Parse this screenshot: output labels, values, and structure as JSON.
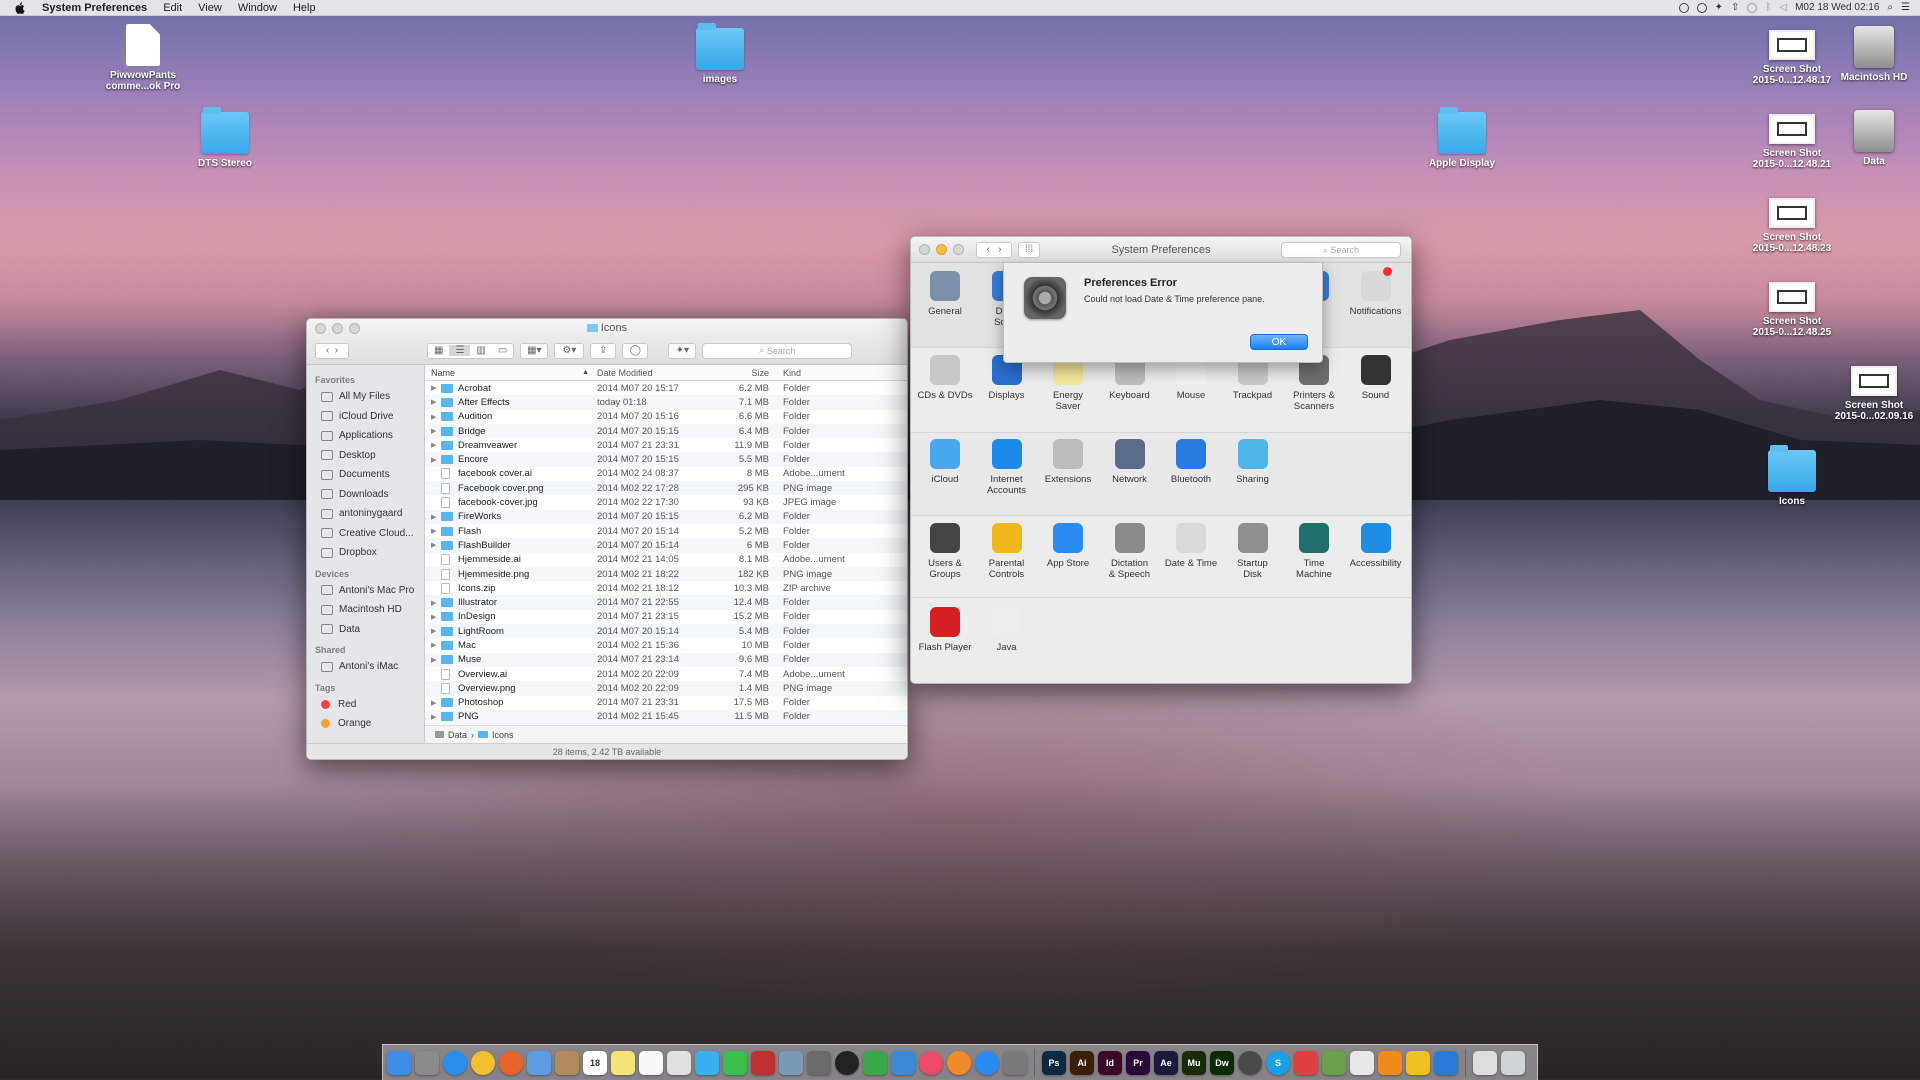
{
  "menubar": {
    "apple": "",
    "app_name": "System Preferences",
    "menus": [
      "Edit",
      "View",
      "Window",
      "Help"
    ],
    "clock": "M02 18 Wed  02:16"
  },
  "desktop_icons": [
    {
      "label": "PiwwowPants\ncomme...ok Pro",
      "type": "doc"
    },
    {
      "label": "DTS Stereo",
      "type": "folder"
    },
    {
      "label": "images",
      "type": "folder"
    },
    {
      "label": "Apple Display",
      "type": "folder"
    },
    {
      "label": "Screen Shot\n2015-0...12.48.17",
      "type": "shot"
    },
    {
      "label": "Macintosh HD",
      "type": "hdd"
    },
    {
      "label": "Screen Shot\n2015-0...12.48.21",
      "type": "shot"
    },
    {
      "label": "Data",
      "type": "hdd"
    },
    {
      "label": "Screen Shot\n2015-0...12.48.23",
      "type": "shot"
    },
    {
      "label": "Screen Shot\n2015-0...12.48.25",
      "type": "shot"
    },
    {
      "label": "Screen Shot\n2015-0...02.09.16",
      "type": "shot"
    },
    {
      "label": "Icons",
      "type": "folder"
    }
  ],
  "finder": {
    "title": "Icons",
    "search_placeholder": "Search",
    "sidebar": {
      "favorites_header": "Favorites",
      "favorites": [
        "All My Files",
        "iCloud Drive",
        "Applications",
        "Desktop",
        "Documents",
        "Downloads",
        "antoninygaard",
        "Creative Cloud...",
        "Dropbox"
      ],
      "devices_header": "Devices",
      "devices": [
        "Antoni's Mac Pro",
        "Macintosh HD",
        "Data"
      ],
      "shared_header": "Shared",
      "shared": [
        "Antoni's iMac"
      ],
      "tags_header": "Tags",
      "tags": [
        {
          "name": "Red",
          "color": "#f0433f"
        },
        {
          "name": "Orange",
          "color": "#f7a131"
        }
      ]
    },
    "columns": {
      "name": "Name",
      "date": "Date Modified",
      "size": "Size",
      "kind": "Kind"
    },
    "files": [
      {
        "name": "Acrobat",
        "date": "2014 M07 20 15:17",
        "size": "6.2 MB",
        "kind": "Folder",
        "folder": true
      },
      {
        "name": "After Effects",
        "date": "today 01:18",
        "size": "7.1 MB",
        "kind": "Folder",
        "folder": true
      },
      {
        "name": "Audition",
        "date": "2014 M07 20 15:16",
        "size": "6.6 MB",
        "kind": "Folder",
        "folder": true
      },
      {
        "name": "Bridge",
        "date": "2014 M07 20 15:15",
        "size": "6.4 MB",
        "kind": "Folder",
        "folder": true
      },
      {
        "name": "Dreamveawer",
        "date": "2014 M07 21 23:31",
        "size": "11.9 MB",
        "kind": "Folder",
        "folder": true
      },
      {
        "name": "Encore",
        "date": "2014 M07 20 15:15",
        "size": "5.5 MB",
        "kind": "Folder",
        "folder": true
      },
      {
        "name": "facebook cover.ai",
        "date": "2014 M02 24 08:37",
        "size": "8 MB",
        "kind": "Adobe...ument",
        "folder": false
      },
      {
        "name": "Facebook cover.png",
        "date": "2014 M02 22 17:28",
        "size": "295 KB",
        "kind": "PNG image",
        "folder": false
      },
      {
        "name": "facebook-cover.jpg",
        "date": "2014 M02 22 17:30",
        "size": "93 KB",
        "kind": "JPEG image",
        "folder": false
      },
      {
        "name": "FireWorks",
        "date": "2014 M07 20 15:15",
        "size": "6.2 MB",
        "kind": "Folder",
        "folder": true
      },
      {
        "name": "Flash",
        "date": "2014 M07 20 15:14",
        "size": "5.2 MB",
        "kind": "Folder",
        "folder": true
      },
      {
        "name": "FlashBuilder",
        "date": "2014 M07 20 15:14",
        "size": "6 MB",
        "kind": "Folder",
        "folder": true
      },
      {
        "name": "Hjemmeside.ai",
        "date": "2014 M02 21 14:05",
        "size": "8.1 MB",
        "kind": "Adobe...ument",
        "folder": false
      },
      {
        "name": "Hjemmeside.png",
        "date": "2014 M02 21 18:22",
        "size": "182 KB",
        "kind": "PNG image",
        "folder": false
      },
      {
        "name": "Icons.zip",
        "date": "2014 M02 21 18:12",
        "size": "10.3 MB",
        "kind": "ZIP archive",
        "folder": false
      },
      {
        "name": "Illustrator",
        "date": "2014 M07 21 22:55",
        "size": "12.4 MB",
        "kind": "Folder",
        "folder": true
      },
      {
        "name": "InDesign",
        "date": "2014 M07 21 23:15",
        "size": "15.2 MB",
        "kind": "Folder",
        "folder": true
      },
      {
        "name": "LightRoom",
        "date": "2014 M07 20 15:14",
        "size": "5.4 MB",
        "kind": "Folder",
        "folder": true
      },
      {
        "name": "Mac",
        "date": "2014 M02 21 15:36",
        "size": "10 MB",
        "kind": "Folder",
        "folder": true
      },
      {
        "name": "Muse",
        "date": "2014 M07 21 23:14",
        "size": "9.6 MB",
        "kind": "Folder",
        "folder": true
      },
      {
        "name": "Overview.ai",
        "date": "2014 M02 20 22:09",
        "size": "7.4 MB",
        "kind": "Adobe...ument",
        "folder": false
      },
      {
        "name": "Overview.png",
        "date": "2014 M02 20 22:09",
        "size": "1.4 MB",
        "kind": "PNG image",
        "folder": false
      },
      {
        "name": "Photoshop",
        "date": "2014 M07 21 23:31",
        "size": "17.5 MB",
        "kind": "Folder",
        "folder": true
      },
      {
        "name": "PNG",
        "date": "2014 M02 21 15:45",
        "size": "11.5 MB",
        "kind": "Folder",
        "folder": true
      }
    ],
    "path": [
      "Data",
      "Icons"
    ],
    "status": "28 items, 2.42 TB available"
  },
  "sysprefs": {
    "title": "System Preferences",
    "search_placeholder": "Search",
    "panes_row1": [
      {
        "label": "General",
        "color": "#7e8fa8"
      },
      {
        "label": "Desk\nScree",
        "color": "#3a7bd5"
      },
      {
        "label": "light",
        "color": "#3a7bd5"
      },
      {
        "label": "Notifications",
        "color": "#d8d8d8"
      }
    ],
    "panes_row2": [
      {
        "label": "CDs & DVDs",
        "color": "#c8c8c8"
      },
      {
        "label": "Displays",
        "color": "#2a6fd0"
      },
      {
        "label": "Energy\nSaver",
        "color": "#f2e79a"
      },
      {
        "label": "Keyboard",
        "color": "#bdbdbd"
      },
      {
        "label": "Mouse",
        "color": "#f0f0f0"
      },
      {
        "label": "Trackpad",
        "color": "#c9c9c9"
      },
      {
        "label": "Printers &\nScanners",
        "color": "#6f6f6f"
      },
      {
        "label": "Sound",
        "color": "#333333"
      }
    ],
    "panes_row3": [
      {
        "label": "iCloud",
        "color": "#4aa8ef"
      },
      {
        "label": "Internet\nAccounts",
        "color": "#1c8ae8"
      },
      {
        "label": "Extensions",
        "color": "#bcbcbc"
      },
      {
        "label": "Network",
        "color": "#5a6b8c"
      },
      {
        "label": "Bluetooth",
        "color": "#2a7be0"
      },
      {
        "label": "Sharing",
        "color": "#4fb6e8"
      }
    ],
    "panes_row4": [
      {
        "label": "Users &\nGroups",
        "color": "#444444"
      },
      {
        "label": "Parental\nControls",
        "color": "#f0b81a"
      },
      {
        "label": "App Store",
        "color": "#2a8cf0"
      },
      {
        "label": "Dictation\n& Speech",
        "color": "#8a8a8a"
      },
      {
        "label": "Date & Time",
        "color": "#d9d9d9"
      },
      {
        "label": "Startup\nDisk",
        "color": "#8f8f8f"
      },
      {
        "label": "Time\nMachine",
        "color": "#1f6f6a"
      },
      {
        "label": "Accessibility",
        "color": "#1f8ce6"
      }
    ],
    "panes_row5": [
      {
        "label": "Flash Player",
        "color": "#d42020"
      },
      {
        "label": "Java",
        "color": "#eeeeee"
      }
    ],
    "alert": {
      "title": "Preferences Error",
      "message": "Could not load Date & Time preference pane.",
      "ok": "OK"
    }
  },
  "dock": {
    "items": [
      {
        "label": "",
        "name": "finder",
        "color": "#3f8ee6"
      },
      {
        "label": "",
        "name": "launchpad",
        "color": "#8a8a8a"
      },
      {
        "label": "",
        "name": "safari",
        "color": "#2a8ef0"
      },
      {
        "label": "",
        "name": "chrome",
        "color": "#f0c030"
      },
      {
        "label": "",
        "name": "firefox",
        "color": "#e8642a"
      },
      {
        "label": "",
        "name": "mail",
        "color": "#5b9be0"
      },
      {
        "label": "",
        "name": "contacts",
        "color": "#b08a5a"
      },
      {
        "label": "18",
        "name": "calendar",
        "color": "#ffffff"
      },
      {
        "label": "",
        "name": "notes",
        "color": "#f6e27a"
      },
      {
        "label": "",
        "name": "reminders",
        "color": "#f8f8f8"
      },
      {
        "label": "",
        "name": "photos",
        "color": "#e0e0e0"
      },
      {
        "label": "",
        "name": "messages",
        "color": "#3ab0f0"
      },
      {
        "label": "",
        "name": "facetime",
        "color": "#3ac04a"
      },
      {
        "label": "",
        "name": "photo-booth",
        "color": "#c03030"
      },
      {
        "label": "",
        "name": "preview",
        "color": "#7a9ab8"
      },
      {
        "label": "",
        "name": "image-capture",
        "color": "#6a6a6a"
      },
      {
        "label": "",
        "name": "dvd-player",
        "color": "#222222"
      },
      {
        "label": "",
        "name": "numbers",
        "color": "#3aa84a"
      },
      {
        "label": "",
        "name": "keynote",
        "color": "#3a8ad8"
      },
      {
        "label": "",
        "name": "itunes",
        "color": "#f04a6a"
      },
      {
        "label": "",
        "name": "ibooks",
        "color": "#f08a2a"
      },
      {
        "label": "",
        "name": "app-store",
        "color": "#2a8cf0"
      },
      {
        "label": "",
        "name": "system-preferences",
        "color": "#7a7a7a"
      },
      {
        "label": "Ps",
        "name": "photoshop",
        "color": "#0b2a40"
      },
      {
        "label": "Ai",
        "name": "illustrator",
        "color": "#3a1e08"
      },
      {
        "label": "Id",
        "name": "indesign",
        "color": "#3a0828"
      },
      {
        "label": "Pr",
        "name": "premiere",
        "color": "#2a0838"
      },
      {
        "label": "Ae",
        "name": "after-effects",
        "color": "#1a1a3a"
      },
      {
        "label": "Mu",
        "name": "muse",
        "color": "#1a2a0a"
      },
      {
        "label": "Dw",
        "name": "dreamweaver",
        "color": "#0a2a08"
      },
      {
        "label": "",
        "name": "istat",
        "color": "#4a4a4a"
      },
      {
        "label": "S",
        "name": "skype",
        "color": "#1aa0e8"
      },
      {
        "label": "",
        "name": "gpu-monitor",
        "color": "#e04040"
      },
      {
        "label": "",
        "name": "utility",
        "color": "#6aa04a"
      },
      {
        "label": "",
        "name": "script-editor",
        "color": "#e8e8e8"
      },
      {
        "label": "",
        "name": "vlc",
        "color": "#f08a1a"
      },
      {
        "label": "",
        "name": "cyberduck",
        "color": "#f0c020"
      },
      {
        "label": "",
        "name": "xcode",
        "color": "#2a7ad8"
      },
      {
        "label": "",
        "name": "downloads-stack",
        "color": "#dddddd"
      },
      {
        "label": "",
        "name": "trash",
        "color": "#cfd2d6"
      }
    ]
  }
}
